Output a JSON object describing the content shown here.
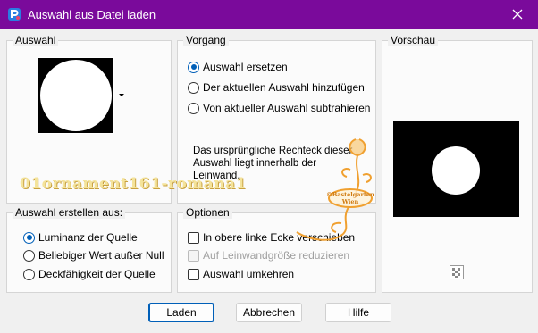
{
  "window": {
    "title": "Auswahl aus Datei laden"
  },
  "groups": {
    "auswahl": {
      "label": "Auswahl"
    },
    "vorgang": {
      "label": "Vorgang",
      "options": [
        {
          "label": "Auswahl ersetzen",
          "checked": true
        },
        {
          "label": "Der aktuellen Auswahl hinzufügen",
          "checked": false
        },
        {
          "label": "Von aktueller Auswahl subtrahieren",
          "checked": false
        }
      ],
      "info": "Das ursprüngliche Rechteck dieser Auswahl liegt innerhalb der Leinwand."
    },
    "vorschau": {
      "label": "Vorschau"
    },
    "erstellen": {
      "label": "Auswahl erstellen aus:",
      "options": [
        {
          "label": "Luminanz der Quelle",
          "checked": true
        },
        {
          "label": "Beliebiger Wert außer Null",
          "checked": false
        },
        {
          "label": "Deckfähigkeit der Quelle",
          "checked": false
        }
      ]
    },
    "optionen": {
      "label": "Optionen",
      "checks": [
        {
          "label": "In obere linke Ecke verschieben",
          "disabled": false
        },
        {
          "label": "Auf Leinwandgröße reduzieren",
          "disabled": true
        },
        {
          "label": "Auswahl umkehren",
          "disabled": false
        }
      ]
    }
  },
  "buttons": {
    "laden": "Laden",
    "abbrechen": "Abbrechen",
    "hilfe": "Hilfe"
  },
  "watermark": {
    "name": "01ornament161-romana1",
    "stamp_line1": "©Bastelgarten",
    "stamp_line2": "Wien"
  },
  "colors": {
    "titlebar": "#7a0a9b",
    "accent": "#005fb8",
    "watermark": "#f0a030"
  },
  "icons": {
    "app": "paint-app-icon",
    "close": "close-icon",
    "dropdown": "dropdown-arrow-icon",
    "checker": "transparency-checker-icon"
  }
}
